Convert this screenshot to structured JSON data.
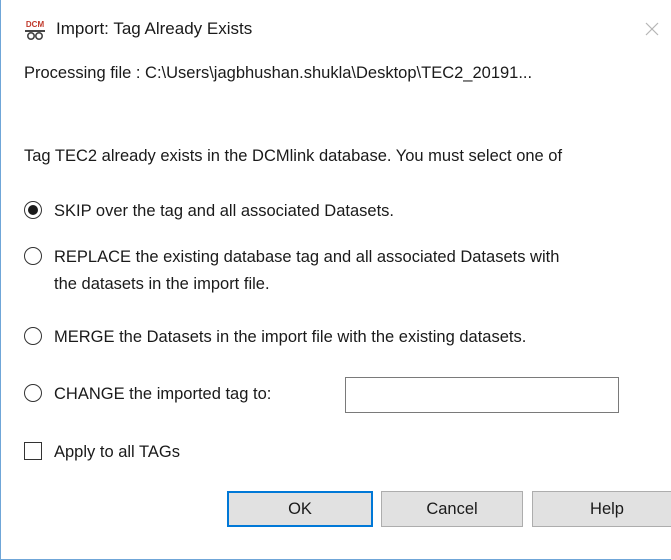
{
  "dialog": {
    "title": "Import: Tag Already Exists",
    "icon": "dcm-app-icon",
    "icon_text": "DCM",
    "processing_text": "Processing file  : C:\\Users\\jagbhushan.shukla\\Desktop\\TEC2_20191...",
    "message": "Tag TEC2 already exists in the DCMlink database. You must select one of"
  },
  "options": {
    "skip": {
      "label": "SKIP over the tag and all associated Datasets.",
      "checked": true
    },
    "replace": {
      "label_line1": "REPLACE the existing database tag and all associated Datasets with",
      "label_line2": "the datasets in the import file.",
      "checked": false
    },
    "merge": {
      "label": "MERGE the Datasets in the import file with the existing datasets.",
      "checked": false
    },
    "change": {
      "label": "CHANGE the imported tag to:",
      "checked": false,
      "value": ""
    }
  },
  "apply_all": {
    "label": "Apply to all TAGs",
    "checked": false
  },
  "buttons": {
    "ok": "OK",
    "cancel": "Cancel",
    "help": "Help"
  },
  "colors": {
    "focus_border": "#0078d7",
    "window_border": "#6fa6d8",
    "button_face": "#e1e1e1"
  }
}
